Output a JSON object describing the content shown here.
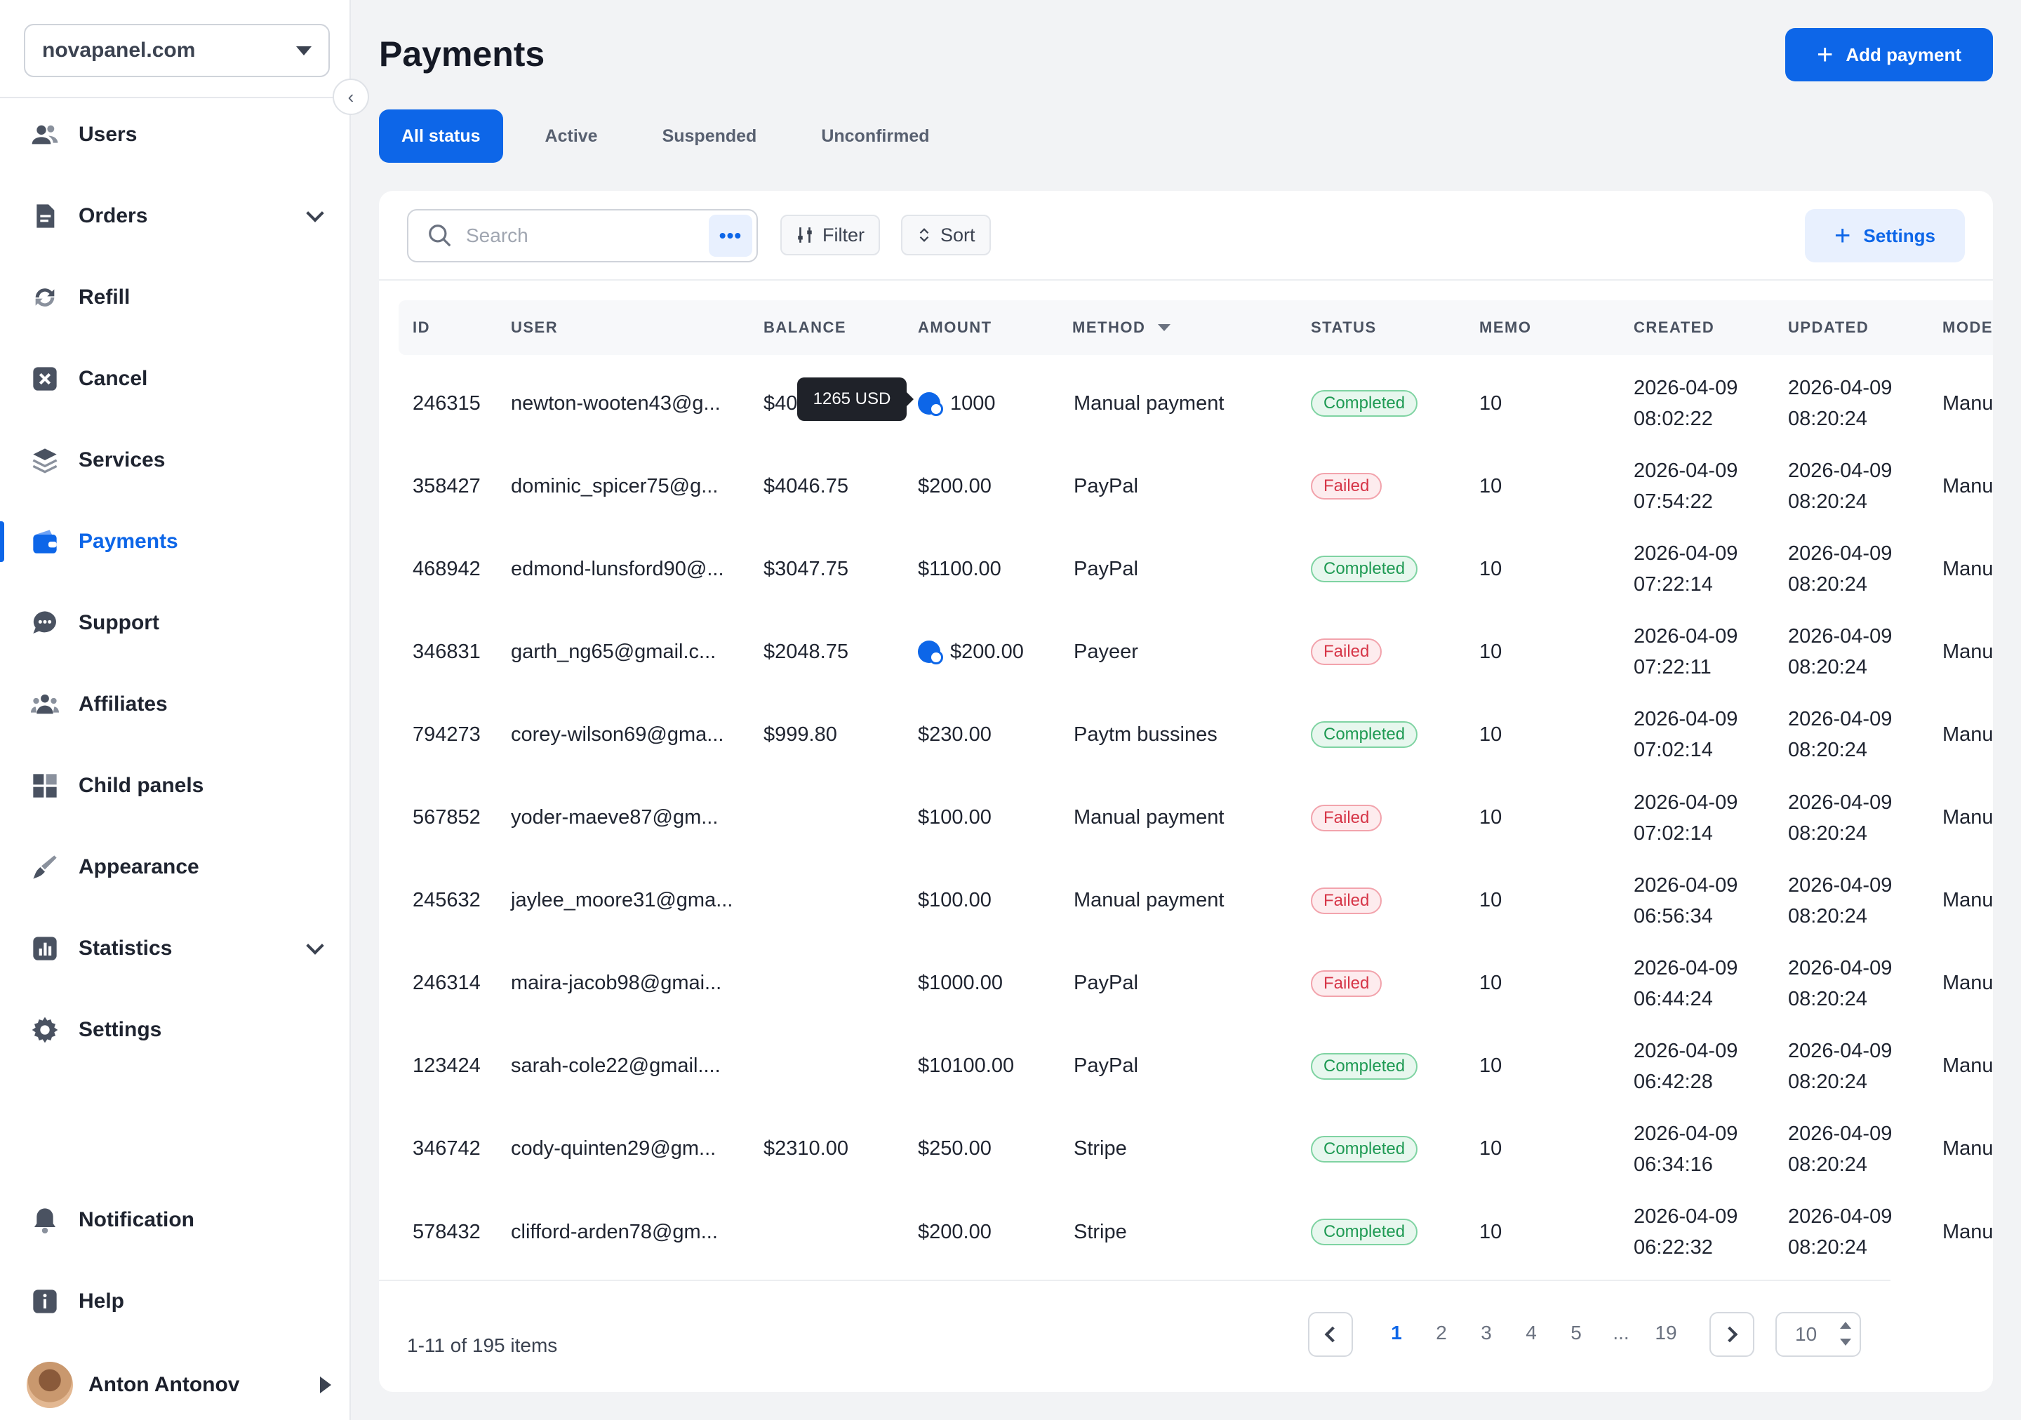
{
  "sidebar": {
    "domain": "novapanel.com",
    "items": [
      {
        "label": "Users",
        "icon": "users-icon"
      },
      {
        "label": "Orders",
        "icon": "orders-icon"
      },
      {
        "label": "Refill",
        "icon": "refill-icon"
      },
      {
        "label": "Cancel",
        "icon": "cancel-icon"
      },
      {
        "label": "Services",
        "icon": "layers-icon"
      },
      {
        "label": "Payments",
        "icon": "wallet-icon"
      },
      {
        "label": "Support",
        "icon": "chat-icon"
      },
      {
        "label": "Affiliates",
        "icon": "group-icon"
      },
      {
        "label": "Child panels",
        "icon": "grid-icon"
      },
      {
        "label": "Appearance",
        "icon": "brush-icon"
      },
      {
        "label": "Statistics",
        "icon": "chart-icon"
      },
      {
        "label": "Settings",
        "icon": "gear-icon"
      }
    ],
    "bottom_items": [
      {
        "label": "Notification",
        "icon": "bell-icon"
      },
      {
        "label": "Help",
        "icon": "info-icon"
      }
    ],
    "user_name": "Anton Antonov"
  },
  "header": {
    "title": "Payments",
    "add_button": "Add payment"
  },
  "tabs": [
    "All status",
    "Active",
    "Suspended",
    "Unconfirmed"
  ],
  "toolbar": {
    "search_placeholder": "Search",
    "filter_label": "Filter",
    "sort_label": "Sort",
    "settings_label": "Settings"
  },
  "tooltip": "1265 USD",
  "table": {
    "columns": [
      "ID",
      "USER",
      "BALANCE",
      "AMOUNT",
      "METHOD",
      "STATUS",
      "MEMO",
      "CREATED",
      "UPDATED",
      "MODE"
    ],
    "rows": [
      {
        "id": "246315",
        "user": "newton-wooten43@g...",
        "balance": "$40",
        "amount": "1000",
        "coin": true,
        "method": "Manual payment",
        "status": "Completed",
        "memo": "10",
        "created_date": "2026-04-09",
        "created_time": "08:02:22",
        "updated_date": "2026-04-09",
        "updated_time": "08:20:24",
        "mode": "Manu"
      },
      {
        "id": "358427",
        "user": "dominic_spicer75@g...",
        "balance": "$4046.75",
        "amount": "$200.00",
        "coin": false,
        "method": "PayPal",
        "status": "Failed",
        "memo": "10",
        "created_date": "2026-04-09",
        "created_time": "07:54:22",
        "updated_date": "2026-04-09",
        "updated_time": "08:20:24",
        "mode": "Manu"
      },
      {
        "id": "468942",
        "user": "edmond-lunsford90@...",
        "balance": "$3047.75",
        "amount": "$1100.00",
        "coin": false,
        "method": "PayPal",
        "status": "Completed",
        "memo": "10",
        "created_date": "2026-04-09",
        "created_time": "07:22:14",
        "updated_date": "2026-04-09",
        "updated_time": "08:20:24",
        "mode": "Manu"
      },
      {
        "id": "346831",
        "user": "garth_ng65@gmail.c...",
        "balance": "$2048.75",
        "amount": "$200.00",
        "coin": true,
        "method": "Payeer",
        "status": "Failed",
        "memo": "10",
        "created_date": "2026-04-09",
        "created_time": "07:22:11",
        "updated_date": "2026-04-09",
        "updated_time": "08:20:24",
        "mode": "Manu"
      },
      {
        "id": "794273",
        "user": "corey-wilson69@gma...",
        "balance": "$999.80",
        "amount": "$230.00",
        "coin": false,
        "method": "Paytm bussines",
        "status": "Completed",
        "memo": "10",
        "created_date": "2026-04-09",
        "created_time": "07:02:14",
        "updated_date": "2026-04-09",
        "updated_time": "08:20:24",
        "mode": "Manu"
      },
      {
        "id": "567852",
        "user": "yoder-maeve87@gm...",
        "balance": "",
        "amount": "$100.00",
        "coin": false,
        "method": "Manual payment",
        "status": "Failed",
        "memo": "10",
        "created_date": "2026-04-09",
        "created_time": "07:02:14",
        "updated_date": "2026-04-09",
        "updated_time": "08:20:24",
        "mode": "Manu"
      },
      {
        "id": "245632",
        "user": "jaylee_moore31@gma...",
        "balance": "",
        "amount": "$100.00",
        "coin": false,
        "method": "Manual payment",
        "status": "Failed",
        "memo": "10",
        "created_date": "2026-04-09",
        "created_time": "06:56:34",
        "updated_date": "2026-04-09",
        "updated_time": "08:20:24",
        "mode": "Manu"
      },
      {
        "id": "246314",
        "user": "maira-jacob98@gmai...",
        "balance": "",
        "amount": "$1000.00",
        "coin": false,
        "method": "PayPal",
        "status": "Failed",
        "memo": "10",
        "created_date": "2026-04-09",
        "created_time": "06:44:24",
        "updated_date": "2026-04-09",
        "updated_time": "08:20:24",
        "mode": "Manu"
      },
      {
        "id": "123424",
        "user": "sarah-cole22@gmail....",
        "balance": "",
        "amount": "$10100.00",
        "coin": false,
        "method": "PayPal",
        "status": "Completed",
        "memo": "10",
        "created_date": "2026-04-09",
        "created_time": "06:42:28",
        "updated_date": "2026-04-09",
        "updated_time": "08:20:24",
        "mode": "Manu"
      },
      {
        "id": "346742",
        "user": "cody-quinten29@gm...",
        "balance": "$2310.00",
        "amount": "$250.00",
        "coin": false,
        "method": "Stripe",
        "status": "Completed",
        "memo": "10",
        "created_date": "2026-04-09",
        "created_time": "06:34:16",
        "updated_date": "2026-04-09",
        "updated_time": "08:20:24",
        "mode": "Manu"
      },
      {
        "id": "578432",
        "user": "clifford-arden78@gm...",
        "balance": "",
        "amount": "$200.00",
        "coin": false,
        "method": "Stripe",
        "status": "Completed",
        "memo": "10",
        "created_date": "2026-04-09",
        "created_time": "06:22:32",
        "updated_date": "2026-04-09",
        "updated_time": "08:20:24",
        "mode": "Manu"
      }
    ]
  },
  "pagination": {
    "range_text": "1-11 of 195 items",
    "pages": [
      "1",
      "2",
      "3",
      "4",
      "5",
      "...",
      "19"
    ],
    "current": "1",
    "per_page": "10"
  },
  "colors": {
    "accent": "#0d66e8",
    "success": "#1e9a53",
    "danger": "#d63648"
  }
}
